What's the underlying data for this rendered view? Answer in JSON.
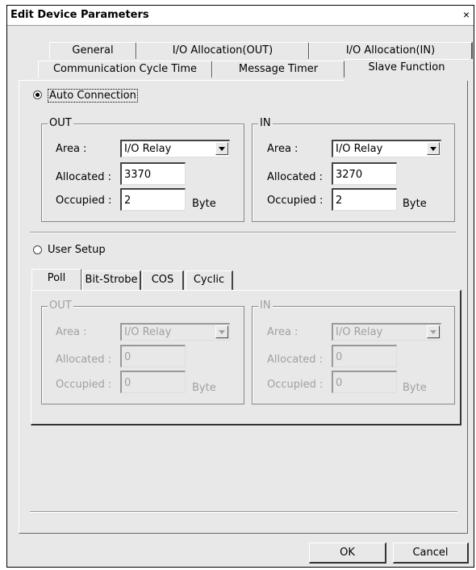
{
  "window": {
    "title": "Edit Device Parameters",
    "close_label": "×"
  },
  "tabs": {
    "row1": [
      "General",
      "I/O Allocation(OUT)",
      "I/O Allocation(IN)"
    ],
    "row2": [
      "Communication Cycle Time",
      "Message Timer",
      "Slave Function"
    ],
    "selected": "Slave Function"
  },
  "auto_connection": {
    "label": "Auto Connection",
    "checked": true,
    "out": {
      "title": "OUT",
      "area_label": "Area :",
      "area_value": "I/O Relay",
      "allocated_label": "Allocated :",
      "allocated_value": "3370",
      "occupied_label": "Occupied :",
      "occupied_value": "2",
      "unit": "Byte"
    },
    "in": {
      "title": "IN",
      "area_label": "Area :",
      "area_value": "I/O Relay",
      "allocated_label": "Allocated :",
      "allocated_value": "3270",
      "occupied_label": "Occupied :",
      "occupied_value": "2",
      "unit": "Byte"
    }
  },
  "user_setup": {
    "label": "User Setup",
    "checked": false,
    "subtabs": [
      "Poll",
      "Bit-Strobe",
      "COS",
      "Cyclic"
    ],
    "selected_subtab": "Poll",
    "out": {
      "title": "OUT",
      "area_label": "Area :",
      "area_value": "I/O Relay",
      "allocated_label": "Allocated :",
      "allocated_value": "0",
      "occupied_label": "Occupied :",
      "occupied_value": "0",
      "unit": "Byte"
    },
    "in": {
      "title": "IN",
      "area_label": "Area :",
      "area_value": "I/O Relay",
      "allocated_label": "Allocated :",
      "allocated_value": "0",
      "occupied_label": "Occupied :",
      "occupied_value": "0",
      "unit": "Byte"
    }
  },
  "buttons": {
    "ok": "OK",
    "cancel": "Cancel"
  }
}
